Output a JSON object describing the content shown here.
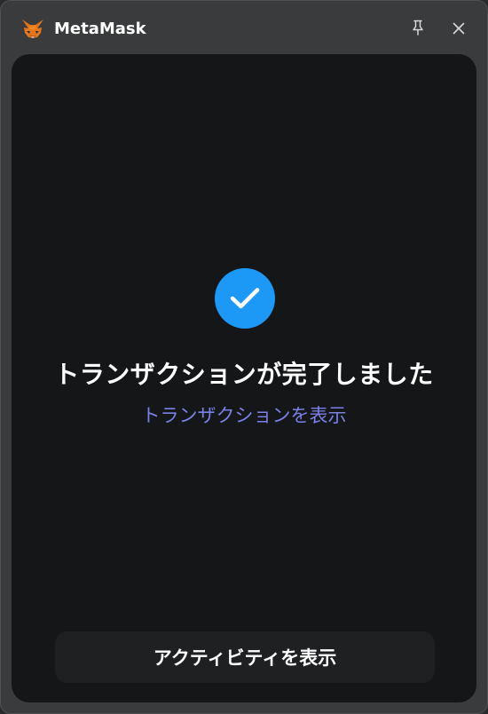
{
  "window": {
    "title": "MetaMask",
    "logo_icon": "metamask-fox-icon",
    "controls": {
      "pin_icon": "pin-icon",
      "close_icon": "close-icon"
    }
  },
  "status": {
    "icon": "check-circle-icon",
    "icon_color": "#1c98f7",
    "headline": "トランザクションが完了しました",
    "view_transaction_link": "トランザクションを表示",
    "link_color": "#7a80e6"
  },
  "footer": {
    "view_activity_label": "アクティビティを表示"
  }
}
